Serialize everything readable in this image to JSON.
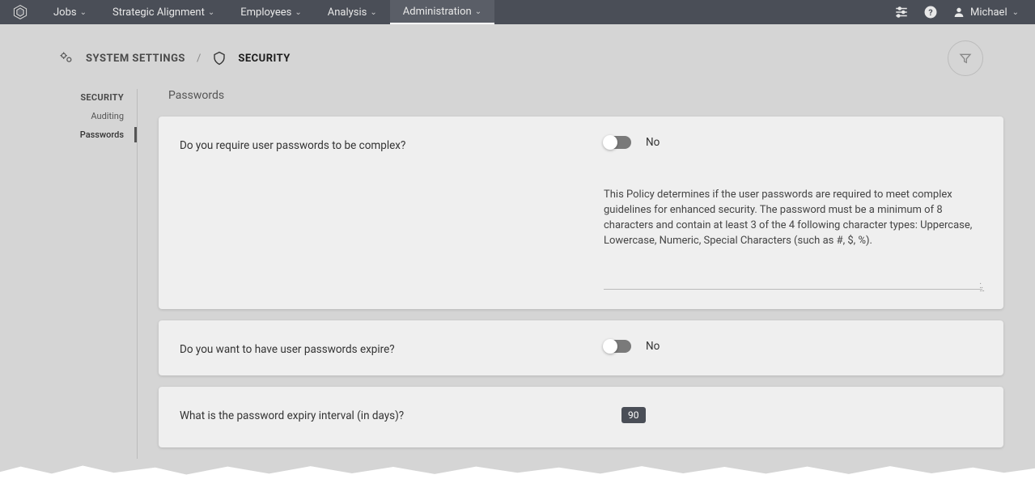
{
  "nav": {
    "items": [
      {
        "label": "Jobs",
        "active": false
      },
      {
        "label": "Strategic Alignment",
        "active": false
      },
      {
        "label": "Employees",
        "active": false
      },
      {
        "label": "Analysis",
        "active": false
      },
      {
        "label": "Administration",
        "active": true
      }
    ],
    "user": "Michael"
  },
  "breadcrumb": {
    "root": "SYSTEM SETTINGS",
    "current": "SECURITY"
  },
  "sidebar": {
    "heading": "SECURITY",
    "items": [
      {
        "label": "Auditing",
        "active": false
      },
      {
        "label": "Passwords",
        "active": true
      }
    ]
  },
  "panel": {
    "title": "Passwords",
    "settings": [
      {
        "question": "Do you require user passwords to be complex?",
        "toggle_value": "No",
        "help": "This Policy determines if the user passwords are required to meet complex guidelines for enhanced security.  The password must be a minimum of 8 characters and contain at least 3 of the 4 following character types: Uppercase, Lowercase, Numeric, Special Characters (such as #, $, %)."
      },
      {
        "question": "Do you want to have user passwords expire?",
        "toggle_value": "No"
      },
      {
        "question": "What is the password expiry interval (in days)?",
        "value": "90"
      }
    ]
  }
}
